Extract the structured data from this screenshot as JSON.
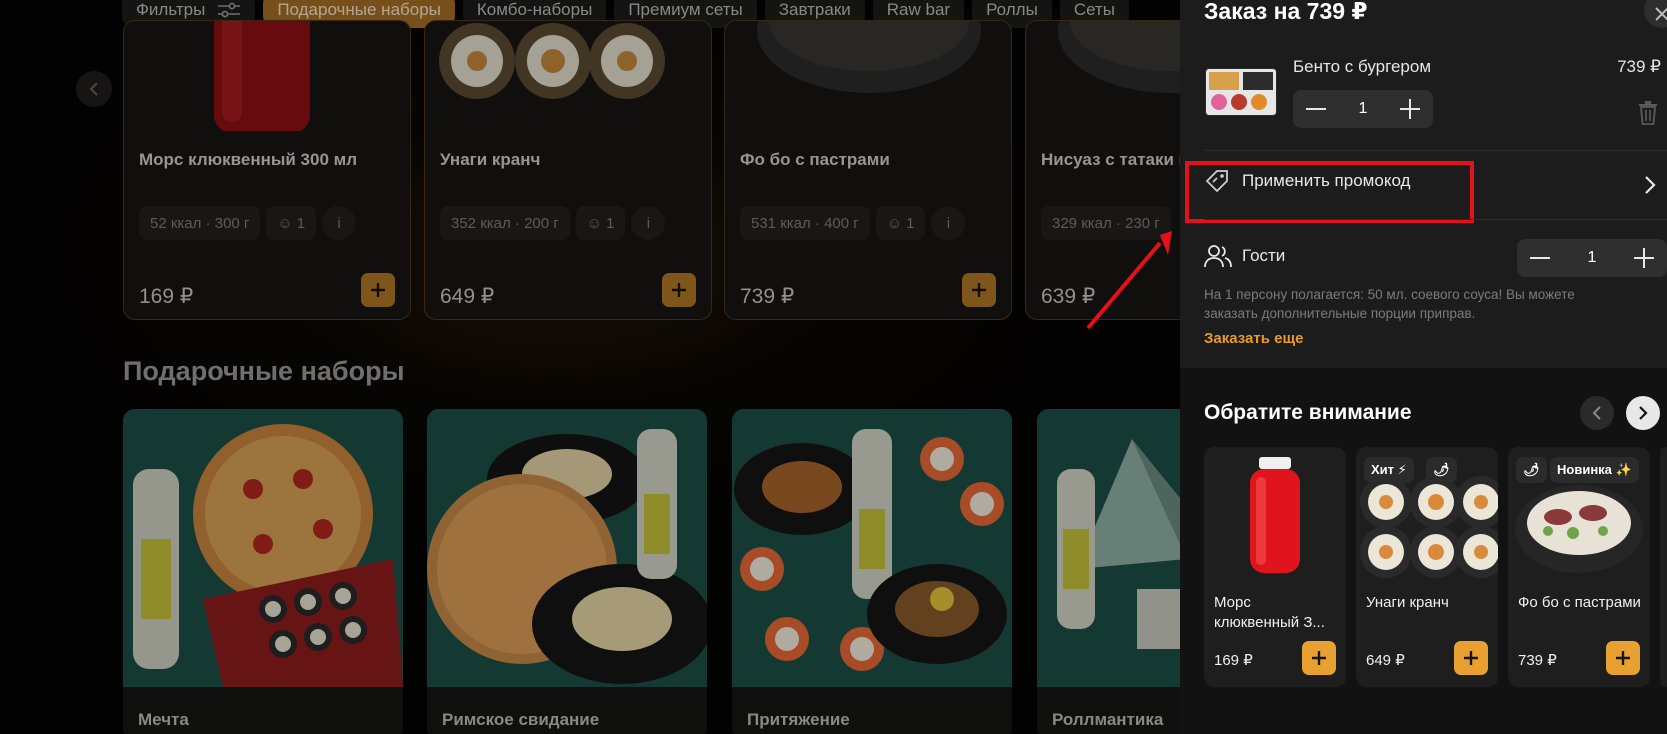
{
  "categories": [
    {
      "label": "Фильтры",
      "active": false,
      "icon": "filter-icon"
    },
    {
      "label": "Подарочные наборы",
      "active": true
    },
    {
      "label": "Комбо-наборы",
      "active": false
    },
    {
      "label": "Премиум сеты",
      "active": false
    },
    {
      "label": "Завтраки",
      "active": false
    },
    {
      "label": "Raw bar",
      "active": false
    },
    {
      "label": "Роллы",
      "active": false
    },
    {
      "label": "Сеты",
      "active": false
    }
  ],
  "products": [
    {
      "name": "Морс клюквенный 300 мл",
      "meta": "52 ккал · 300 г",
      "persons": "1",
      "price": "169 ₽"
    },
    {
      "name": "Унаги кранч",
      "meta": "352 ккал · 200 г",
      "persons": "1",
      "price": "649 ₽"
    },
    {
      "name": "Фо бо с пастрами",
      "meta": "531 ккал · 400 г",
      "persons": "1",
      "price": "739 ₽"
    },
    {
      "name": "Нисуаз с татаки и",
      "meta": "329 ккал · 230 г",
      "persons": "1",
      "price": "639 ₽"
    }
  ],
  "gift_section": {
    "title": "Подарочные наборы",
    "items": [
      {
        "name": "Мечта"
      },
      {
        "name": "Римское свидание"
      },
      {
        "name": "Притяжение"
      },
      {
        "name": "Роллмантика"
      }
    ]
  },
  "cart": {
    "title": "Заказ на 739 ₽",
    "item": {
      "name": "Бенто с бургером",
      "price": "739 ₽",
      "qty": "1"
    },
    "promo_label": "Применить промокод",
    "guests_label": "Гости",
    "guests_qty": "1",
    "guests_note": "На 1 персону полагается: 50 мл. соевого соуса! Вы можете заказать дополнительные порции приправ.",
    "order_more": "Заказать еще",
    "attention_title": "Обратите внимание",
    "recommendations": [
      {
        "name": "Морс клюквенный З...",
        "price": "169 ₽"
      },
      {
        "name": "Унаги кранч",
        "price": "649 ₽",
        "badge": "Хит ⚡",
        "badge2": "🌶"
      },
      {
        "name": "Фо бо с пастрами",
        "price": "739 ₽",
        "badge": "Новинка ✨",
        "badge2": "🌶"
      }
    ]
  },
  "colors": {
    "accent": "#e8a030",
    "highlight": "#e3111a",
    "panel": "#1c1c1c"
  }
}
